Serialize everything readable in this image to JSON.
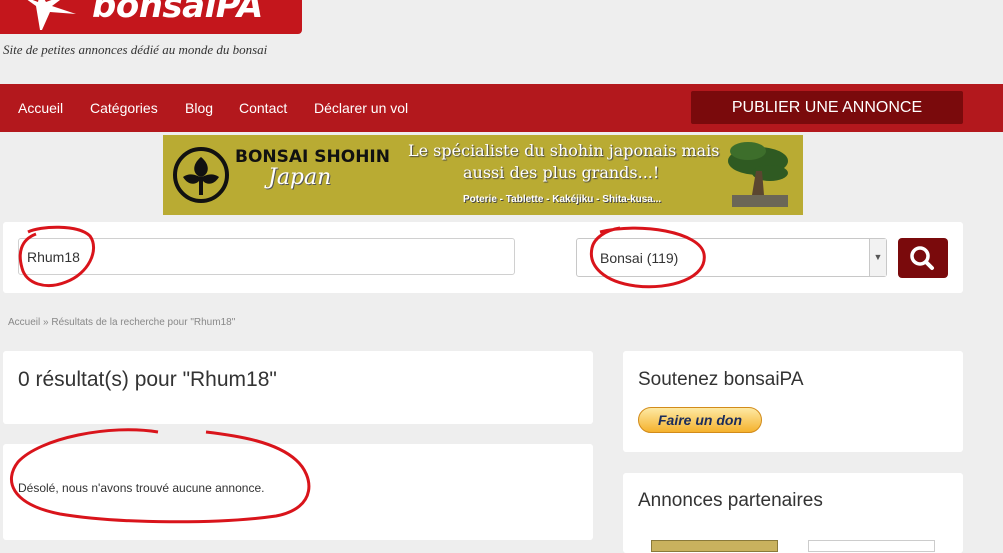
{
  "header": {
    "logo_text": "bonsaiPA",
    "tagline": "Site de petites annonces dédié au monde du bonsai"
  },
  "nav": {
    "items": [
      "Accueil",
      "Catégories",
      "Blog",
      "Contact",
      "Déclarer un vol"
    ],
    "publish_label": "PUBLIER UNE ANNONCE"
  },
  "banner": {
    "brand": "BONSAI SHOHIN",
    "subbrand": "Japan",
    "line1": "Le spécialiste du shohin japonais mais",
    "line2": "aussi des plus grands...!",
    "bottom": "Poterie - Tablette - Kakéjiku - Shita-kusa..."
  },
  "search": {
    "query_value": "Rhum18",
    "category_value": "Bonsai  (119)",
    "button_icon": "search-icon"
  },
  "breadcrumb": {
    "home": "Accueil",
    "separator": " » ",
    "current": "Résultats de la recherche pour \"Rhum18\""
  },
  "results": {
    "title": "0 résultat(s) pour \"Rhum18\"",
    "empty_message": "Désolé, nous n'avons trouvé aucune annonce."
  },
  "sidebar": {
    "support_title": "Soutenez bonsaiPA",
    "donate_label": "Faire un don",
    "partners_title": "Annonces partenaires"
  },
  "colors": {
    "brand_red": "#c4161c",
    "nav_red": "#b3181d",
    "dark_red": "#7a0a0c",
    "annotation_red": "#d9141b"
  }
}
